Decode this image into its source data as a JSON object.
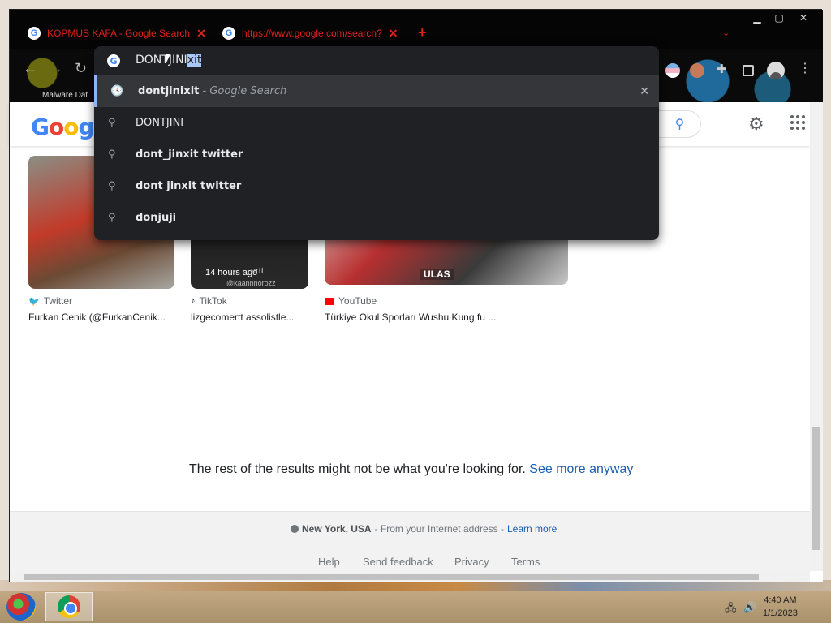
{
  "browser": {
    "tabs": [
      {
        "title": "KOPMUS KAFA - Google Search",
        "favicon": "G"
      },
      {
        "title": "https://www.google.com/search?",
        "favicon": "G"
      }
    ],
    "bookmark_label": "Malware Dat"
  },
  "omnibox": {
    "typed": "DONTJINI",
    "autocomplete": "xit",
    "suggestions": [
      {
        "icon": "history-icon",
        "bold": "dontjinixit",
        "sub": " - Google Search",
        "remove": "✕"
      },
      {
        "icon": "search-icon",
        "bold": "",
        "plain": "DONTJINI"
      },
      {
        "icon": "search-icon",
        "bold": "dont_jinxit twitter"
      },
      {
        "icon": "search-icon",
        "bold": "dont jinxit twitter"
      },
      {
        "icon": "search-icon",
        "bold": "donjuji"
      }
    ]
  },
  "page": {
    "logo": "Google",
    "cards": [
      {
        "source": "Twitter",
        "title": "Furkan Cenik (@FurkanCenik..."
      },
      {
        "source": "TikTok",
        "title": "lizgecomertt assolistle...",
        "overlay": "14 hours ago",
        "overlay_sub": "@kaannnorozz",
        "overlay_handle": "ertt"
      },
      {
        "source": "YouTube",
        "title": "Türkiye Okul Sporları Wushu Kung fu ...",
        "overlay": "ULAS"
      }
    ],
    "rest_message": "The rest of the results might not be what you're looking for.",
    "see_more": "See more anyway",
    "footer": {
      "location_city": "New York, USA",
      "location_suffix": " - From your Internet address - ",
      "learn_more": "Learn more",
      "links": [
        "Help",
        "Send feedback",
        "Privacy",
        "Terms"
      ]
    }
  },
  "taskbar": {
    "time": "4:40 AM",
    "date": "1/1/2023"
  }
}
